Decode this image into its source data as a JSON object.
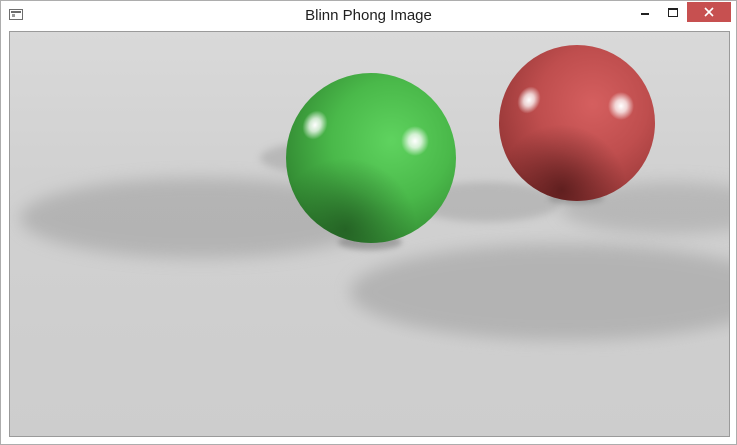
{
  "window": {
    "title": "Blinn Phong Image"
  },
  "controls": {
    "minimize_icon": "minimize-icon",
    "maximize_icon": "maximize-icon",
    "close_icon": "close-icon"
  },
  "scene": {
    "spheres": [
      {
        "name": "green-sphere",
        "color": "#4caf50"
      },
      {
        "name": "red-sphere",
        "color": "#c0504d"
      }
    ],
    "floor_color": "#d0d0d0"
  }
}
